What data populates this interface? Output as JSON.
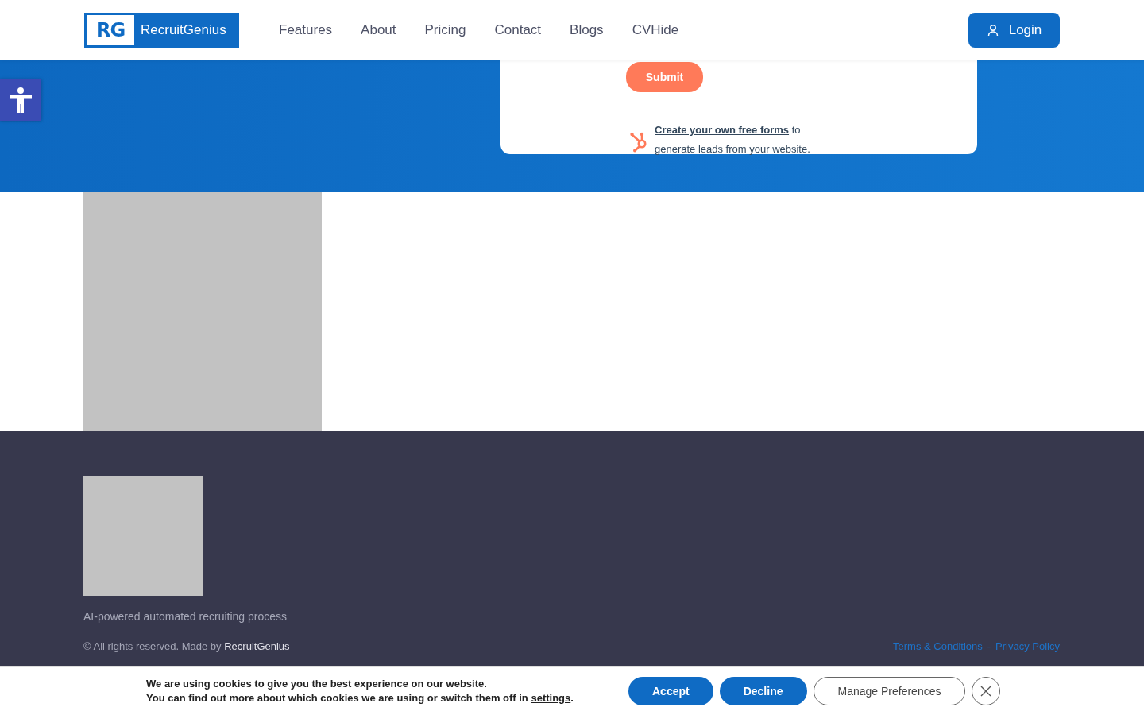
{
  "header": {
    "logo": {
      "mark": "RG",
      "name": "RecruitGenius"
    },
    "nav": [
      {
        "label": "Features"
      },
      {
        "label": "About"
      },
      {
        "label": "Pricing"
      },
      {
        "label": "Contact"
      },
      {
        "label": "Blogs"
      },
      {
        "label": "CVHide"
      }
    ],
    "login": "Login"
  },
  "form_card": {
    "submit": "Submit",
    "promo_link": "Create your own free forms",
    "promo_rest": " to generate leads from your website."
  },
  "footer": {
    "tagline": "AI-powered automated recruiting process",
    "copyright": "© All rights reserved. Made by ",
    "copyright_brand": "RecruitGenius",
    "links": [
      {
        "label": "Terms & Conditions"
      },
      {
        "label": "Privacy Policy"
      }
    ],
    "link_separator": "-"
  },
  "cookie_bar": {
    "line1": "We are using cookies to give you the best experience on our website.",
    "line2": "You can find out more about which cookies we are using or switch them off in ",
    "settings_link": "settings",
    "line2_end": ".",
    "buttons": [
      {
        "label": "Accept",
        "kind": "primary"
      },
      {
        "label": "Decline",
        "kind": "primary"
      },
      {
        "label": "Manage Preferences",
        "kind": "outline"
      }
    ]
  }
}
